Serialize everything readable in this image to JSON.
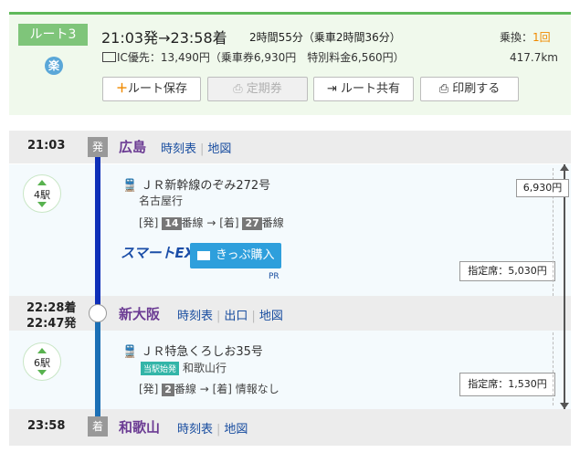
{
  "header": {
    "route_label": "ルート3",
    "raku_badge": "楽",
    "departure_arrival": "21:03発→23:58着",
    "duration": "2時間55分（乗車2時間36分）",
    "transfer_label": "乗換：",
    "transfer_count": "1回",
    "fare_line": "IC優先：13,490円（乗車券6,930円　特別料金6,560円）",
    "distance": "417.7km",
    "buttons": {
      "save": "ルート保存",
      "commuter": "定期券",
      "share": "ルート共有",
      "print": "印刷する"
    }
  },
  "stations": [
    {
      "time": "21:03",
      "badge": "発",
      "name": "広島",
      "links": [
        "時刻表",
        "地図"
      ]
    },
    {
      "time_arr": "22:28着",
      "time_dep": "22:47発",
      "name": "新大阪",
      "links": [
        "時刻表",
        "出口",
        "地図"
      ]
    },
    {
      "time": "23:58",
      "badge": "着",
      "name": "和歌山",
      "links": [
        "時刻表",
        "地図"
      ]
    }
  ],
  "segments": [
    {
      "stops": "4駅",
      "train": "ＪＲ新幹線のぞみ272号",
      "destination": "名古屋行",
      "dep_label": "[発]",
      "dep_platform": "14",
      "arrow": "→",
      "arr_label": "[着]",
      "arr_platform": "27",
      "platform_suffix": "番線",
      "smartex": "スマートEX",
      "kippu": "きっぷ購入",
      "pr": "PR",
      "reserved": "指定席：5,030円"
    },
    {
      "stops": "6駅",
      "train": "ＪＲ特急くろしお35号",
      "first_train": "当駅始発",
      "destination": "和歌山行",
      "dep_label": "[発]",
      "dep_platform": "2",
      "platform_suffix": "番線",
      "arrow": "→",
      "arr_label": "[着]",
      "arr_info": "情報なし",
      "reserved": "指定席：1,530円"
    }
  ],
  "total_fare_box": "6,930円",
  "colors": {
    "header_bg": "#f0f9ec",
    "route_tag": "#7fc57a",
    "station_name": "#6b3b93",
    "link": "#1a4ea0",
    "shinkansen_line": "#0e2fb8",
    "limited_express_line": "#1b6fb5"
  }
}
